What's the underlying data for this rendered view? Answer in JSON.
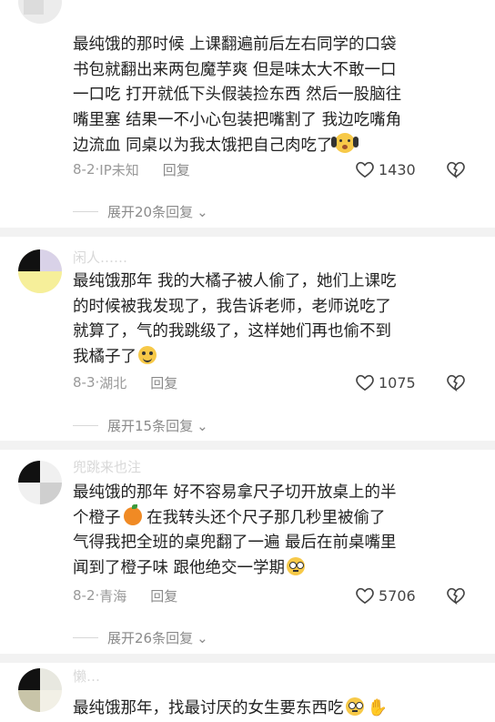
{
  "comments": [
    {
      "text_lines": [
        "最纯饿的那时候 上课翻遍前后左右同学的口袋",
        "书包就翻出来两包魔芋爽 但是味太大不敢一口",
        "一口吃 打开就低下头假装捡东西 然后一股脑往",
        "嘴里塞 结果一不小心包装把嘴割了 我边吃嘴角",
        "边流血 同桌以为我太饿把自己肉吃了"
      ],
      "emoji": "screaming-face-emoji",
      "date": "8-2",
      "location": "IP未知",
      "reply_label": "回复",
      "likes": "1430",
      "expand_label": "展开20条回复"
    },
    {
      "username": "闲人……",
      "text_lines": [
        "最纯饿那年 我的大橘子被人偷了，她们上课吃",
        "的时候被我发现了，我告诉老师，老师说吃了",
        "就算了，气的我跳级了，这样她们再也偷不到",
        "我橘子了"
      ],
      "emoji": "smiling-face-emoji",
      "date": "8-3",
      "location": "湖北",
      "reply_label": "回复",
      "likes": "1075",
      "expand_label": "展开15条回复"
    },
    {
      "username": "兜跳来也注",
      "text_lines": [
        "最纯饿的那年 好不容易拿尺子切开放桌上的半",
        "个橙子",
        "气得我把全班的桌兜翻了一遍 最后在前桌嘴里",
        "闻到了橙子味 跟他绝交一学期"
      ],
      "orange_emoji": "orange-emoji",
      "line2_rest": " 在我转头还个尺子那几秒里被偷了",
      "emoji": "flushed-face-emoji",
      "date": "8-2",
      "location": "青海",
      "reply_label": "回复",
      "likes": "5706",
      "expand_label": "展开26条回复"
    },
    {
      "username": "懒…",
      "text_lines": [
        "最纯饿那年，找最讨厌的女生要东西吃"
      ],
      "emoji": "flushed-face-emoji",
      "emoji2": "folded-hands-emoji"
    }
  ],
  "colors": {
    "text": "#222222",
    "meta": "#999999",
    "divider": "#f2f2f2"
  }
}
